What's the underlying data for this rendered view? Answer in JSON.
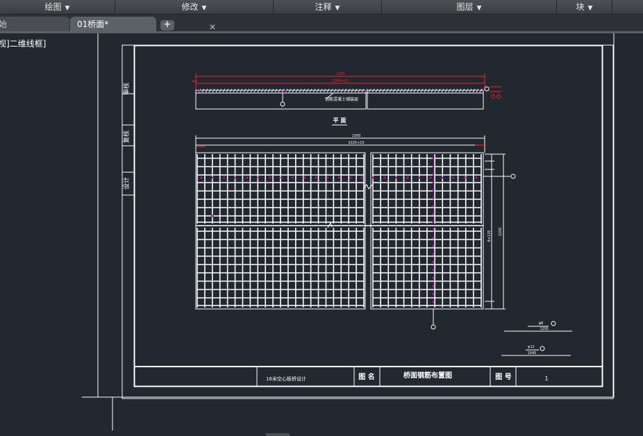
{
  "ribbon": {
    "panels": [
      {
        "label": "绘图"
      },
      {
        "label": "修改"
      },
      {
        "label": "注释"
      },
      {
        "label": "图层"
      },
      {
        "label": "块"
      }
    ]
  },
  "tabs": {
    "start_label": "始",
    "file_label": "01桥面*",
    "close_glyph": "✕",
    "add_glyph": "+"
  },
  "viewport": {
    "label": "视]二维线框]"
  },
  "drawing": {
    "side_labels": [
      "审核",
      "复核",
      "设计"
    ],
    "top_dim_total": "1300",
    "top_dim_sub": "1266+15",
    "top_bar_label": "钢筋混凝土铺装层",
    "callout_1": "①",
    "callout_2": "②",
    "section_title": "平  面",
    "plan_dim_total": "1300",
    "plan_dim_sub": "1025+15",
    "right_dim_total": "1250",
    "right_dim_sub": "8×125",
    "legend_1_top": "φ8",
    "legend_1_bottom": "1291",
    "legend_2_top": "φ12",
    "legend_2_bottom": "1045",
    "title_block": {
      "project": "16米空心板桥设计",
      "drawing_name_label": "图  名",
      "drawing_name": "桥面钢筋布置图",
      "drawing_no_label": "图  号",
      "drawing_no": "1"
    }
  },
  "colors": {
    "canvas": "#212830",
    "line": "#ffffff",
    "dimension": "#ff2020",
    "rebar_dot": "#c000c0"
  }
}
